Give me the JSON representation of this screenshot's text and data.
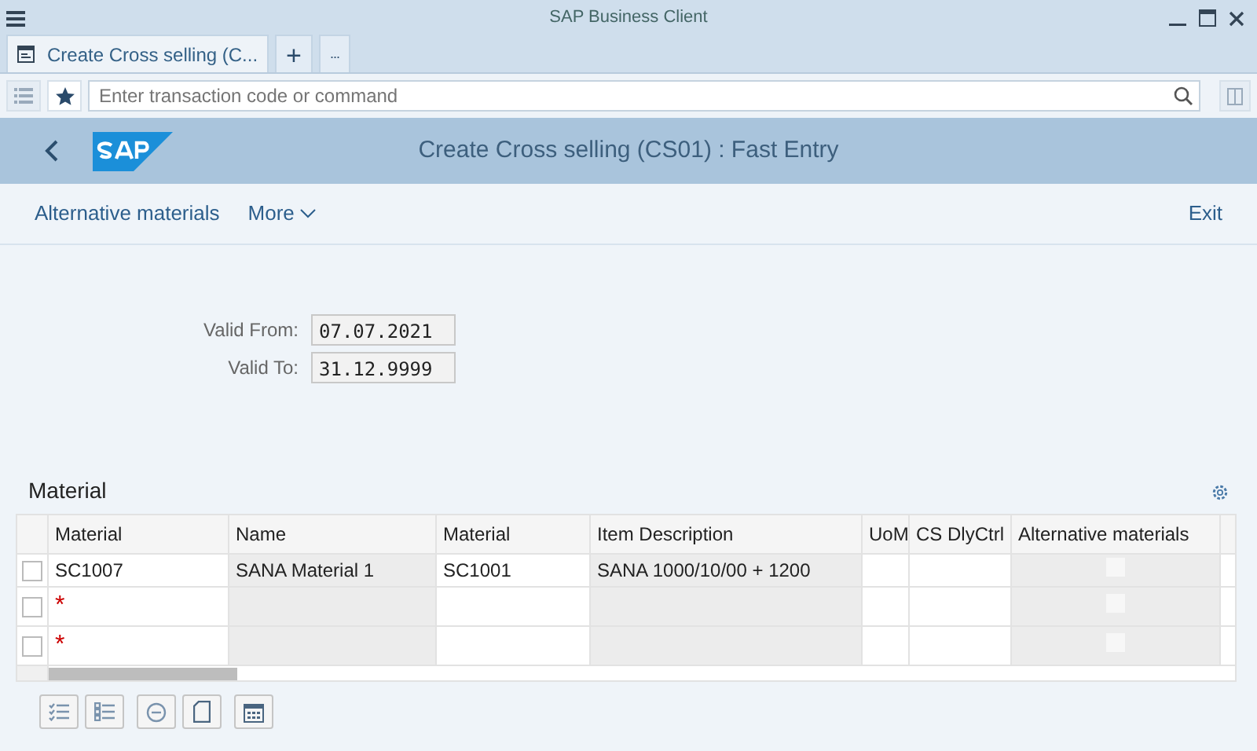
{
  "window": {
    "title": "SAP Business Client"
  },
  "tabs": [
    {
      "label": "Create Cross selling (C...",
      "selected": true
    }
  ],
  "tab_actions": [
    "+",
    "..."
  ],
  "command": {
    "placeholder": "Enter transaction code or command"
  },
  "header": {
    "title": "Create Cross selling (CS01) : Fast Entry"
  },
  "toolbar": {
    "items": [
      {
        "label": "Alternative materials",
        "kind": "link"
      },
      {
        "label": "More",
        "kind": "menu"
      }
    ],
    "exit": "Exit"
  },
  "fields": [
    {
      "label": "Valid From:",
      "value": "07.07.2021"
    },
    {
      "label": "Valid To:",
      "value": "31.12.9999"
    }
  ],
  "table": {
    "title": "Material",
    "columns": [
      {
        "label": "Material",
        "editable": true,
        "kind": "text"
      },
      {
        "label": "Name",
        "editable": false,
        "kind": "text"
      },
      {
        "label": "Material",
        "editable": true,
        "kind": "text"
      },
      {
        "label": "Item Description",
        "editable": false,
        "kind": "text"
      },
      {
        "label": "UoM",
        "editable": true,
        "kind": "text"
      },
      {
        "label": "CS DlyCtrl",
        "editable": true,
        "kind": "text"
      },
      {
        "label": "Alternative materials",
        "editable": false,
        "kind": "checkbox"
      }
    ],
    "rows": [
      {
        "selected": false,
        "cells": [
          "SC1007",
          "SANA Material 1",
          "SC1001",
          "SANA 1000/10/00 + 1200",
          "",
          "",
          false
        ]
      },
      {
        "selected": false,
        "cells": [
          "*",
          "",
          "",
          "",
          "",
          "",
          false
        ]
      },
      {
        "selected": false,
        "cells": [
          "*",
          "",
          "",
          "",
          "",
          "",
          false
        ]
      }
    ]
  }
}
